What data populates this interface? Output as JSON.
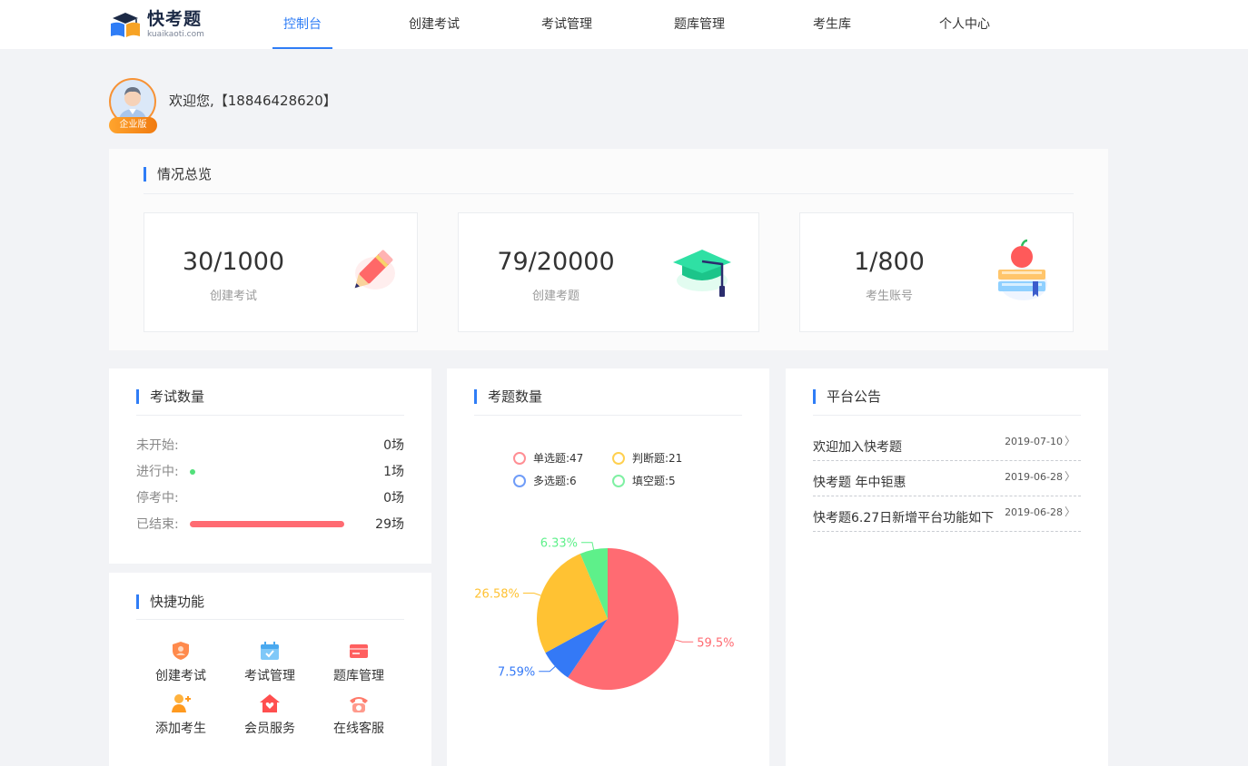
{
  "brand": {
    "name": "快考题",
    "domain": "kuaikaoti.com"
  },
  "nav": [
    {
      "label": "控制台",
      "active": true
    },
    {
      "label": "创建考试",
      "active": false
    },
    {
      "label": "考试管理",
      "active": false
    },
    {
      "label": "题库管理",
      "active": false
    },
    {
      "label": "考生库",
      "active": false
    },
    {
      "label": "个人中心",
      "active": false
    }
  ],
  "user": {
    "welcome": "欢迎您,【18846428620】",
    "edition": "企业版"
  },
  "overview": {
    "title": "情况总览",
    "stats": [
      {
        "value": "30/1000",
        "label": "创建考试",
        "icon": "pencil-icon"
      },
      {
        "value": "79/20000",
        "label": "创建考题",
        "icon": "graduation-cap-icon"
      },
      {
        "value": "1/800",
        "label": "考生账号",
        "icon": "books-apple-icon"
      }
    ]
  },
  "exam_count": {
    "title": "考试数量",
    "rows": [
      {
        "label": "未开始:",
        "value": "0场",
        "count": 0
      },
      {
        "label": "进行中:",
        "value": "1场",
        "count": 1
      },
      {
        "label": "停考中:",
        "value": "0场",
        "count": 0
      },
      {
        "label": "已结束:",
        "value": "29场",
        "count": 29
      }
    ]
  },
  "quick": {
    "title": "快捷功能",
    "items": [
      {
        "label": "创建考试",
        "icon": "shield-icon"
      },
      {
        "label": "考试管理",
        "icon": "calendar-check-icon"
      },
      {
        "label": "题库管理",
        "icon": "card-icon"
      },
      {
        "label": "添加考生",
        "icon": "add-user-icon"
      },
      {
        "label": "会员服务",
        "icon": "house-heart-icon"
      },
      {
        "label": "在线客服",
        "icon": "telephone-icon"
      }
    ]
  },
  "question_count": {
    "title": "考题数量",
    "legend": [
      {
        "label": "单选题:47",
        "color": "#ff6b72"
      },
      {
        "label": "判断题:21",
        "color": "#ffc233"
      },
      {
        "label": "多选题:6",
        "color": "#3479f6"
      },
      {
        "label": "填空题:5",
        "color": "#5ef08a"
      }
    ],
    "chart_data": {
      "type": "pie",
      "categories": [
        "单选题",
        "多选题",
        "判断题",
        "填空题"
      ],
      "values": [
        47,
        6,
        21,
        5
      ],
      "labels": [
        "59.5%",
        "7.59%",
        "26.58%",
        "6.33%"
      ],
      "colors": [
        "#ff6b72",
        "#3479f6",
        "#ffc233",
        "#5ef08a"
      ]
    }
  },
  "notices": {
    "title": "平台公告",
    "items": [
      {
        "text": "欢迎加入快考题",
        "date": "2019-07-10"
      },
      {
        "text": "快考题 年中钜惠",
        "date": "2019-06-28"
      },
      {
        "text": "快考题6.27日新增平台功能如下",
        "date": "2019-06-28"
      }
    ]
  }
}
